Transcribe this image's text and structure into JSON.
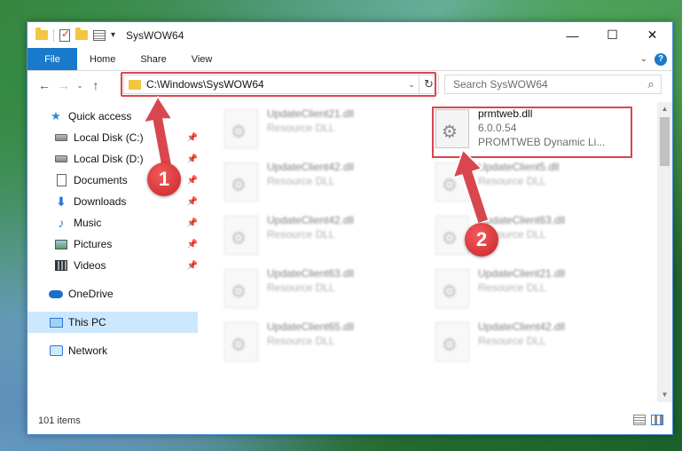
{
  "window": {
    "title": "SysWOW64",
    "controls": {
      "minimize": "—",
      "maximize": "☐",
      "close": "✕"
    }
  },
  "ribbon": {
    "tabs": [
      "File",
      "Home",
      "Share",
      "View"
    ],
    "help": "?"
  },
  "navigation": {
    "back": "←",
    "forward": "→",
    "recent": "⌄",
    "up": "↑",
    "address": "C:\\Windows\\SysWOW64",
    "search_placeholder": "Search SysWOW64"
  },
  "sidebar": {
    "items": [
      {
        "label": "Quick access",
        "icon": "star-icon"
      },
      {
        "label": "Local Disk (C:)",
        "icon": "drive-icon",
        "pinned": true
      },
      {
        "label": "Local Disk (D:)",
        "icon": "drive-icon",
        "pinned": true
      },
      {
        "label": "Documents",
        "icon": "documents-icon",
        "pinned": true
      },
      {
        "label": "Downloads",
        "icon": "downloads-icon",
        "pinned": true
      },
      {
        "label": "Music",
        "icon": "music-icon",
        "pinned": true
      },
      {
        "label": "Pictures",
        "icon": "pictures-icon",
        "pinned": true
      },
      {
        "label": "Videos",
        "icon": "videos-icon",
        "pinned": true
      },
      {
        "label": "OneDrive",
        "icon": "onedrive-icon"
      },
      {
        "label": "This PC",
        "icon": "pc-icon",
        "selected": true
      },
      {
        "label": "Network",
        "icon": "network-icon"
      }
    ]
  },
  "files": [
    {
      "name": "UpdateClient21.dll",
      "type": "Resource DLL",
      "blurred": true
    },
    {
      "name": "prmtweb.dll",
      "version": "6.0.0.54",
      "description": "PROMTWEB Dynamic Li...",
      "blurred": false,
      "highlighted": true
    },
    {
      "name": "UpdateClient42.dll",
      "type": "Resource DLL",
      "blurred": true
    },
    {
      "name": "UpdateClient5.dll",
      "type": "Resource DLL",
      "blurred": true
    },
    {
      "name": "UpdateClient42.dll",
      "type": "Resource DLL",
      "blurred": true
    },
    {
      "name": "UpdateClient63.dll",
      "type": "Resource DLL",
      "blurred": true
    },
    {
      "name": "UpdateClient63.dll",
      "type": "Resource DLL",
      "blurred": true
    },
    {
      "name": "UpdateClient21.dll",
      "type": "Resource DLL",
      "blurred": true
    },
    {
      "name": "UpdateClient65.dll",
      "type": "Resource DLL",
      "blurred": true
    },
    {
      "name": "UpdateClient42.dll",
      "type": "Resource DLL",
      "blurred": true
    }
  ],
  "status": {
    "item_count": "101 items"
  },
  "annotations": {
    "step1": "1",
    "step2": "2",
    "color": "#d9474e"
  }
}
